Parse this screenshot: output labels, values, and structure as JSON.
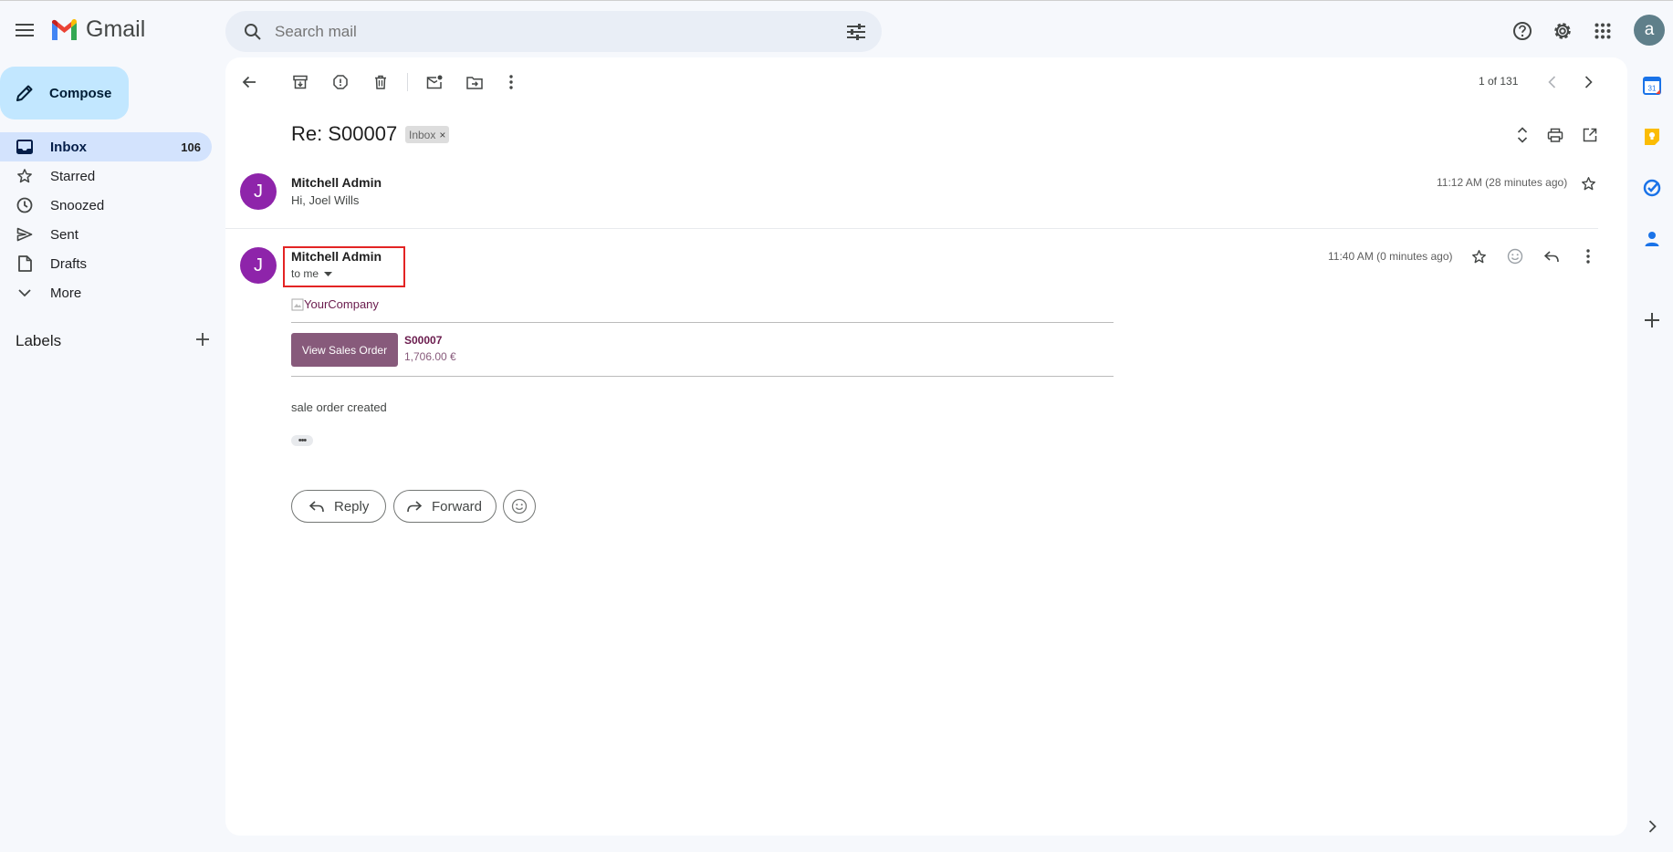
{
  "app": {
    "name": "Gmail"
  },
  "search": {
    "placeholder": "Search mail"
  },
  "header": {
    "account_initial": "a"
  },
  "sidebar": {
    "compose_label": "Compose",
    "items": [
      {
        "label": "Inbox",
        "count": "106",
        "icon": "inbox-icon"
      },
      {
        "label": "Starred",
        "count": "",
        "icon": "star-icon"
      },
      {
        "label": "Snoozed",
        "count": "",
        "icon": "clock-icon"
      },
      {
        "label": "Sent",
        "count": "",
        "icon": "send-icon"
      },
      {
        "label": "Drafts",
        "count": "",
        "icon": "draft-icon"
      },
      {
        "label": "More",
        "count": "",
        "icon": "chevron-down-icon"
      }
    ],
    "labels_title": "Labels"
  },
  "toolbar": {
    "pagination": "1 of 131"
  },
  "thread": {
    "subject": "Re: S00007",
    "label_chip": "Inbox",
    "label_chip_close": "×",
    "messages": [
      {
        "sender": "Mitchell Admin",
        "avatar_initial": "J",
        "snippet": "Hi, Joel Wills",
        "time": "11:12 AM (28 minutes ago)"
      },
      {
        "sender": "Mitchell Admin",
        "avatar_initial": "J",
        "to": "to me",
        "time": "11:40 AM (0 minutes ago)",
        "body": {
          "logo_alt": "YourCompany",
          "button_label": "View Sales Order",
          "order_ref": "S00007",
          "order_amount": "1,706.00 €",
          "text": "sale order created",
          "trimmed_indicator": "•••"
        }
      }
    ],
    "reply_label": "Reply",
    "forward_label": "Forward"
  },
  "colors": {
    "accent": "#c2e7ff",
    "inbox_active": "#d3e3fd",
    "avatar": "#8e24aa",
    "odoo_button": "#875a7b",
    "highlight_box": "#e32424"
  }
}
